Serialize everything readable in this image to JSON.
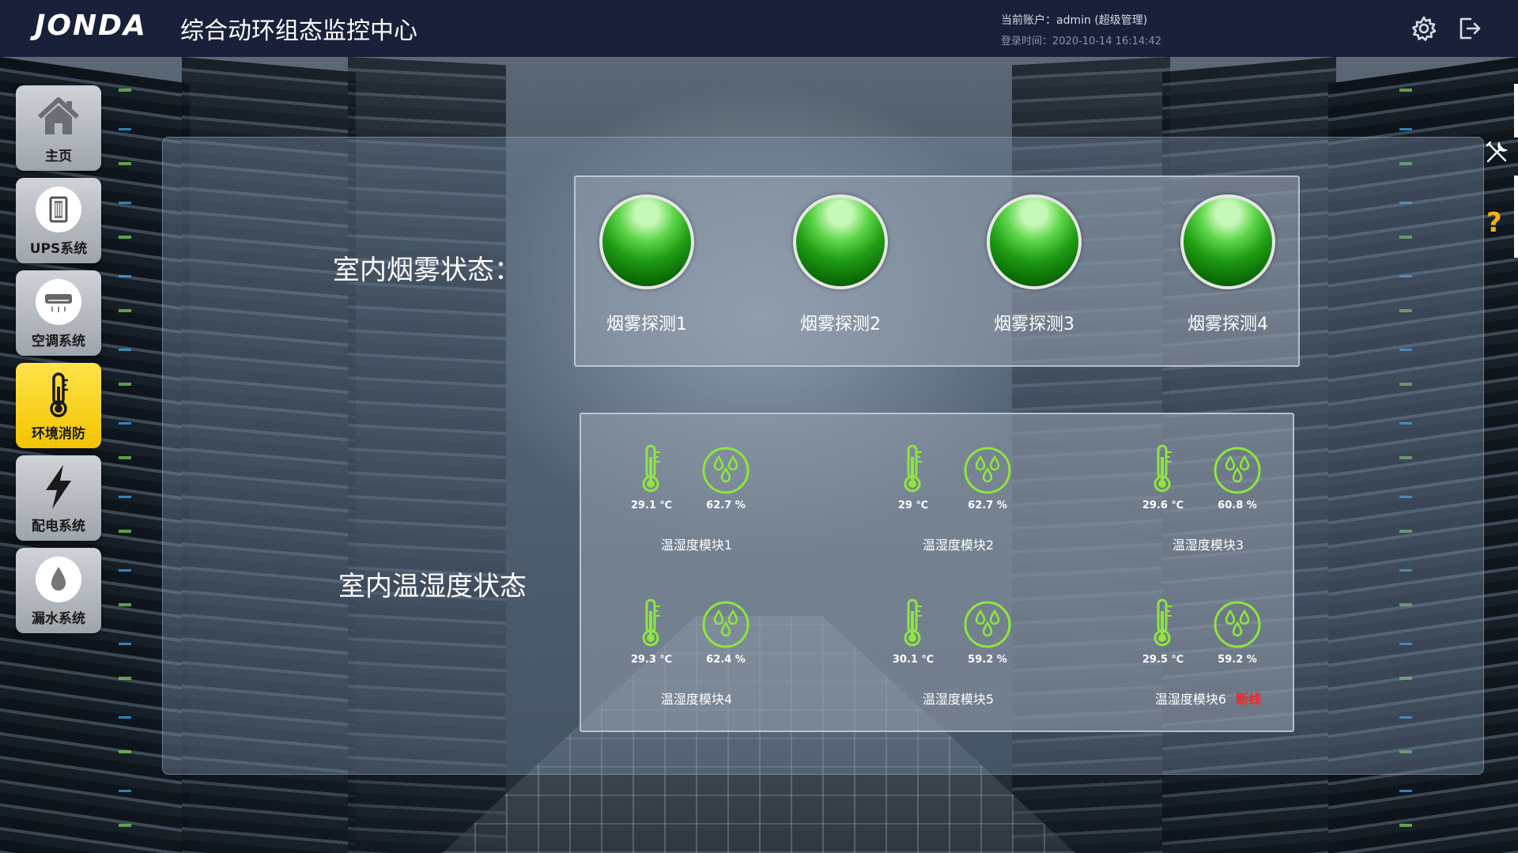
{
  "header": {
    "logo_text": "JONDA",
    "title": "综合动环组态监控中心",
    "account": "当前账户：admin (超级管理)",
    "login_time": "登录时间：2020-10-14 16:14:42",
    "icons": [
      "gear-icon",
      "logout-icon"
    ]
  },
  "sidebar": {
    "items": [
      {
        "label": "主页",
        "icon": "home-icon",
        "active": false
      },
      {
        "label": "UPS系统",
        "icon": "ups-icon",
        "active": false
      },
      {
        "label": "空调系统",
        "icon": "air-conditioner-icon",
        "active": false
      },
      {
        "label": "环境消防",
        "icon": "thermometer-icon",
        "active": true
      },
      {
        "label": "配电系统",
        "icon": "lightning-icon",
        "active": false
      },
      {
        "label": "漏水系统",
        "icon": "water-drop-icon",
        "active": false
      }
    ]
  },
  "main": {
    "smoke_title": "室内烟雾状态：",
    "smoke_detectors": [
      {
        "label": "烟雾探测1",
        "status": "normal"
      },
      {
        "label": "烟雾探测2",
        "status": "normal"
      },
      {
        "label": "烟雾探测3",
        "status": "normal"
      },
      {
        "label": "烟雾探测4",
        "status": "normal"
      }
    ],
    "th_title": "室内温湿度状态",
    "modules": [
      {
        "label": "温湿度模块1",
        "temp": "29.1 ℃",
        "humidity": "62.7 %",
        "status": ""
      },
      {
        "label": "温湿度模块2",
        "temp": "29 ℃",
        "humidity": "62.7 %",
        "status": ""
      },
      {
        "label": "温湿度模块3",
        "temp": "29.6 ℃",
        "humidity": "60.8 %",
        "status": ""
      },
      {
        "label": "温湿度模块4",
        "temp": "29.3 ℃",
        "humidity": "62.4 %",
        "status": ""
      },
      {
        "label": "温湿度模块5",
        "temp": "30.1 ℃",
        "humidity": "59.2 %",
        "status": ""
      },
      {
        "label": "温湿度模块6",
        "temp": "29.5 ℃",
        "humidity": "59.2 %",
        "status": "断线"
      }
    ]
  },
  "tools": {
    "icons": [
      "tools-icon",
      "help-icon"
    ],
    "help_text": "?"
  },
  "colors": {
    "header_bg": "#19213a",
    "active_nav": "#f2c400",
    "indicator_green": "#1f9d14",
    "sensor_green": "#8ee63c",
    "offline_red": "#ff2222"
  }
}
